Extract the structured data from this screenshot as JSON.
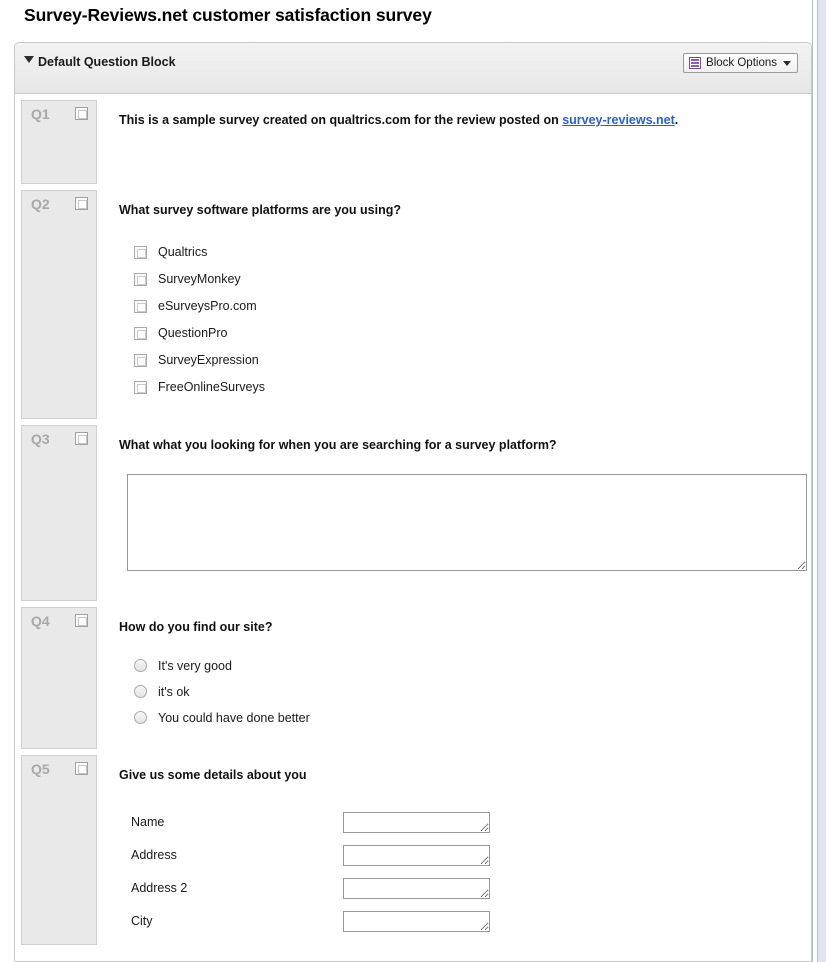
{
  "survey": {
    "title": "Survey-Reviews.net customer satisfaction survey"
  },
  "block": {
    "title": "Default Question Block",
    "collapse_icon": "triangle-down-icon",
    "options_button": {
      "label": "Block Options",
      "icon": "block-options-icon",
      "caret_icon": "chevron-down-icon",
      "accent_color": "#8e5fb0"
    }
  },
  "questions": [
    {
      "tag": "Q1",
      "type": "descriptive-text",
      "text_before_link": "This is a sample survey created on qualtrics.com for the review posted on ",
      "link_text": "survey-reviews.net",
      "text_after_link": ".",
      "link_color": "#2b5fd0"
    },
    {
      "tag": "Q2",
      "type": "multiple-choice-checkbox",
      "text": "What survey software platforms are you using?",
      "choices": [
        "Qualtrics",
        "SurveyMonkey",
        "eSurveysPro.com",
        "QuestionPro",
        "SurveyExpression",
        "FreeOnlineSurveys"
      ]
    },
    {
      "tag": "Q3",
      "type": "text-entry-essay",
      "text": "What what you looking for when you are searching for a survey platform?",
      "answer_value": "",
      "answer_placeholder": ""
    },
    {
      "tag": "Q4",
      "type": "multiple-choice-radio",
      "text": "How do you find our site?",
      "choices": [
        "It's very good",
        "it's ok",
        "You could have done better"
      ]
    },
    {
      "tag": "Q5",
      "type": "text-entry-form",
      "text": "Give us some details about you",
      "fields": [
        {
          "label": "Name",
          "value": ""
        },
        {
          "label": "Address",
          "value": ""
        },
        {
          "label": "Address 2",
          "value": ""
        },
        {
          "label": "City",
          "value": ""
        }
      ]
    }
  ]
}
